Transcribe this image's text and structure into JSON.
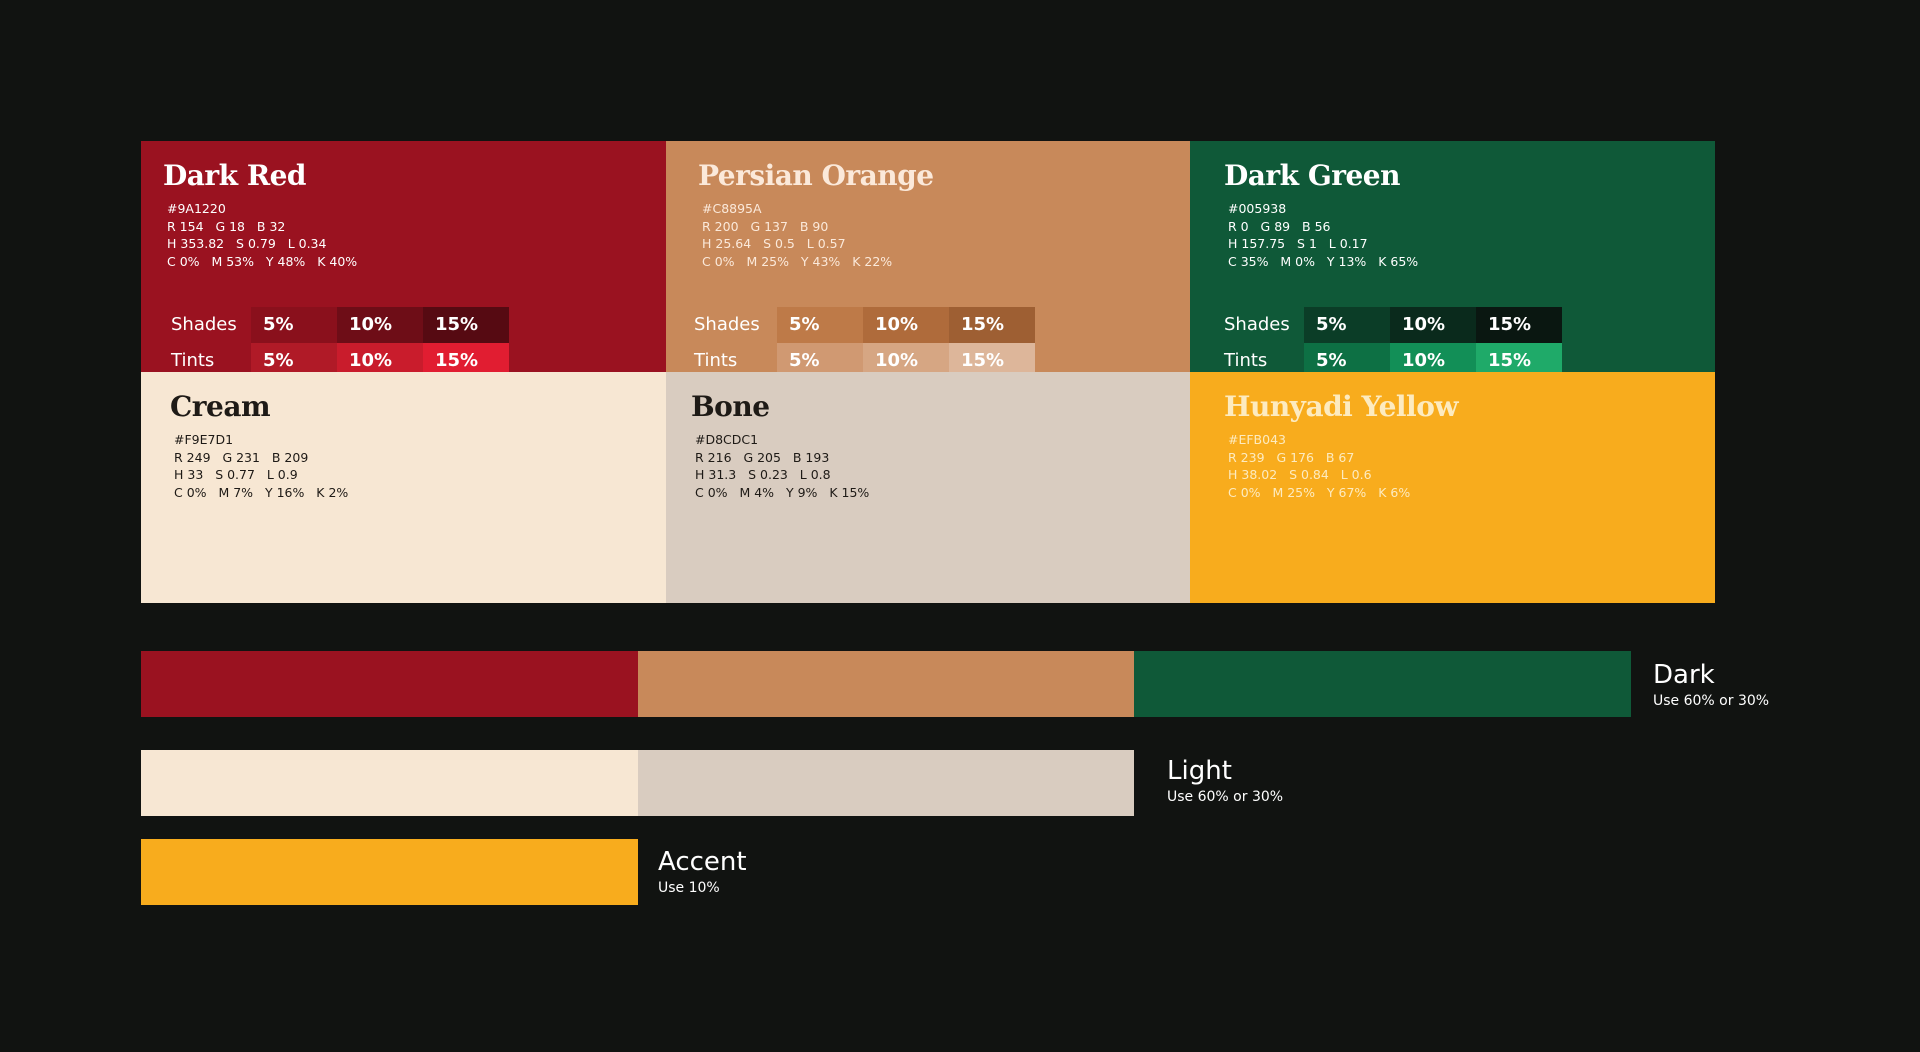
{
  "colors": {
    "dark_red": {
      "name": "Dark Red",
      "hex_label": "#9A1220",
      "fill": "#9A1220",
      "text_color": "#ffffff",
      "rgb": "R 154   G 18   B 32",
      "hsl": "H 353.82   S 0.79   L 0.34",
      "cmyk": "C 0%   M 53%   Y 48%   K 40%",
      "shades_label": "Shades",
      "tints_label": "Tints",
      "shades": [
        {
          "label": "5%",
          "fill": "#8A101C"
        },
        {
          "label": "10%",
          "fill": "#6E0D17"
        },
        {
          "label": "15%",
          "fill": "#560A12"
        }
      ],
      "tints": [
        {
          "label": "5%",
          "fill": "#B01A27"
        },
        {
          "label": "10%",
          "fill": "#C91C2C"
        },
        {
          "label": "15%",
          "fill": "#E11D31"
        }
      ]
    },
    "persian_orange": {
      "name": "Persian Orange",
      "hex_label": "#C8895A",
      "fill": "#C8895A",
      "text_color": "#fbe9da",
      "rgb": "R 200   G 137   B 90",
      "hsl": "H 25.64   S 0.5   L 0.57",
      "cmyk": "C 0%   M 25%   Y 43%   K 22%",
      "shades_label": "Shades",
      "tints_label": "Tints",
      "shades": [
        {
          "label": "5%",
          "fill": "#BE7A48"
        },
        {
          "label": "10%",
          "fill": "#AF6B3B"
        },
        {
          "label": "15%",
          "fill": "#9E5F33"
        }
      ],
      "tints": [
        {
          "label": "5%",
          "fill": "#D09972"
        },
        {
          "label": "10%",
          "fill": "#D6A683"
        },
        {
          "label": "15%",
          "fill": "#DDB69A"
        }
      ]
    },
    "dark_green": {
      "name": "Dark Green",
      "hex_label": "#005938",
      "fill": "#0F5938",
      "text_color": "#ffffff",
      "rgb": "R 0   G 89   B 56",
      "hsl": "H 157.75   S 1   L 0.17",
      "cmyk": "C 35%   M 0%   Y 13%   K 65%",
      "shades_label": "Shades",
      "tints_label": "Tints",
      "shades": [
        {
          "label": "5%",
          "fill": "#0B3D27"
        },
        {
          "label": "10%",
          "fill": "#0A2A1C"
        },
        {
          "label": "15%",
          "fill": "#0A1711"
        }
      ],
      "tints": [
        {
          "label": "5%",
          "fill": "#0D7044"
        },
        {
          "label": "10%",
          "fill": "#128F57"
        },
        {
          "label": "15%",
          "fill": "#1FAA69"
        }
      ]
    },
    "cream": {
      "name": "Cream",
      "hex_label": "#F9E7D1",
      "fill": "#F7E7D3",
      "text_color": "#1e1a16",
      "rgb": "R 249   G 231   B 209",
      "hsl": "H 33   S 0.77   L 0.9",
      "cmyk": "C 0%   M 7%   Y 16%   K 2%"
    },
    "bone": {
      "name": "Bone",
      "hex_label": "#D8CDC1",
      "fill": "#D9CCC0",
      "text_color": "#1e1a16",
      "rgb": "R 216   G 205   B 193",
      "hsl": "H 31.3   S 0.23   L 0.8",
      "cmyk": "C 0%   M 4%   Y 9%   K 15%"
    },
    "hunyadi_yellow": {
      "name": "Hunyadi Yellow",
      "hex_label": "#EFB043",
      "fill": "#F8AC1D",
      "text_color": "#fdebc0",
      "rgb": "R 239   G 176   B 67",
      "hsl": "H 38.02   S 0.84   L 0.6",
      "cmyk": "C 0%   M 25%   Y 67%   K 6%"
    }
  },
  "usage": {
    "dark": {
      "title": "Dark",
      "subtitle": "Use 60% or 30%"
    },
    "light": {
      "title": "Light",
      "subtitle": "Use 60% or 30%"
    },
    "accent": {
      "title": "Accent",
      "subtitle": "Use 10%"
    }
  }
}
